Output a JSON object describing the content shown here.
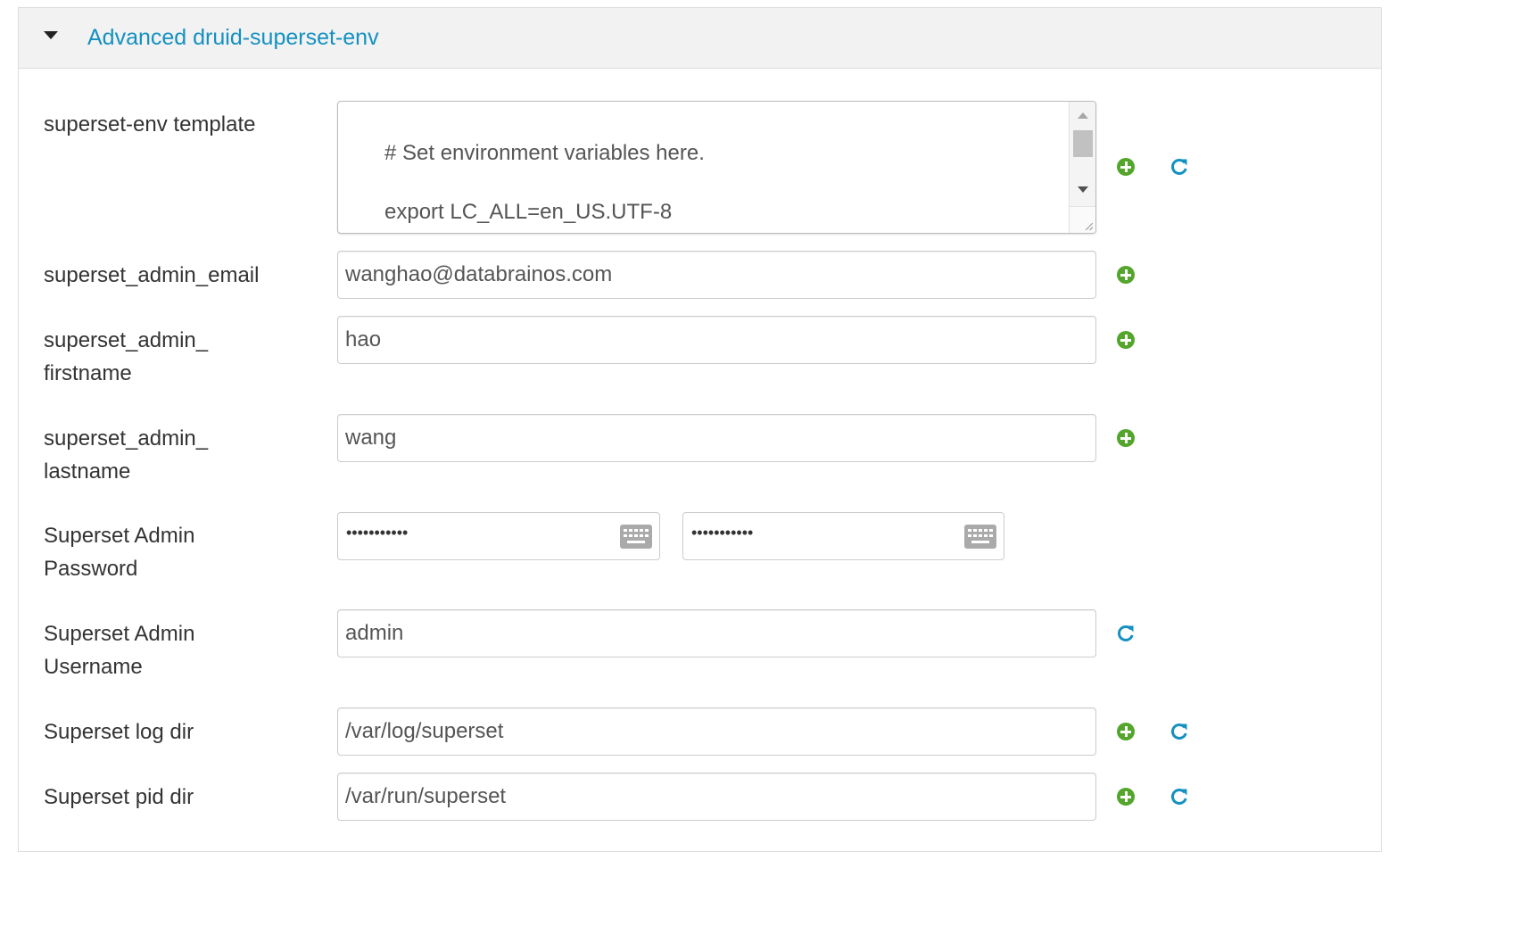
{
  "section": {
    "title": "Advanced druid-superset-env"
  },
  "fields": {
    "template": {
      "label": "superset-env template",
      "lines": [
        "# Set environment variables here.",
        "export LC_ALL=en_US.UTF-8"
      ]
    },
    "admin_email": {
      "label": "superset_admin_email",
      "value": "wanghao@databrainos.com"
    },
    "admin_firstname": {
      "label_line1": "superset_admin_",
      "label_line2": "firstname",
      "value": "hao"
    },
    "admin_lastname": {
      "label_line1": "superset_admin_",
      "label_line2": "lastname",
      "value": "wang"
    },
    "admin_password": {
      "label_line1": "Superset Admin",
      "label_line2": "Password",
      "value": "•••••••••••",
      "confirm_value": "•••••••••••"
    },
    "admin_username": {
      "label_line1": "Superset Admin",
      "label_line2": "Username",
      "value": "admin"
    },
    "log_dir": {
      "label": "Superset log dir",
      "value": "/var/log/superset"
    },
    "pid_dir": {
      "label": "Superset pid dir",
      "value": "/var/run/superset"
    }
  },
  "icons": {
    "expand": "caret-down-icon",
    "add": "plus-circle-icon",
    "reset": "refresh-icon",
    "keyboard": "keyboard-icon"
  },
  "colors": {
    "title_link": "#1491c1",
    "add_icon": "#53a52b",
    "refresh_icon": "#1491c1",
    "header_bg": "#f2f2f2"
  }
}
